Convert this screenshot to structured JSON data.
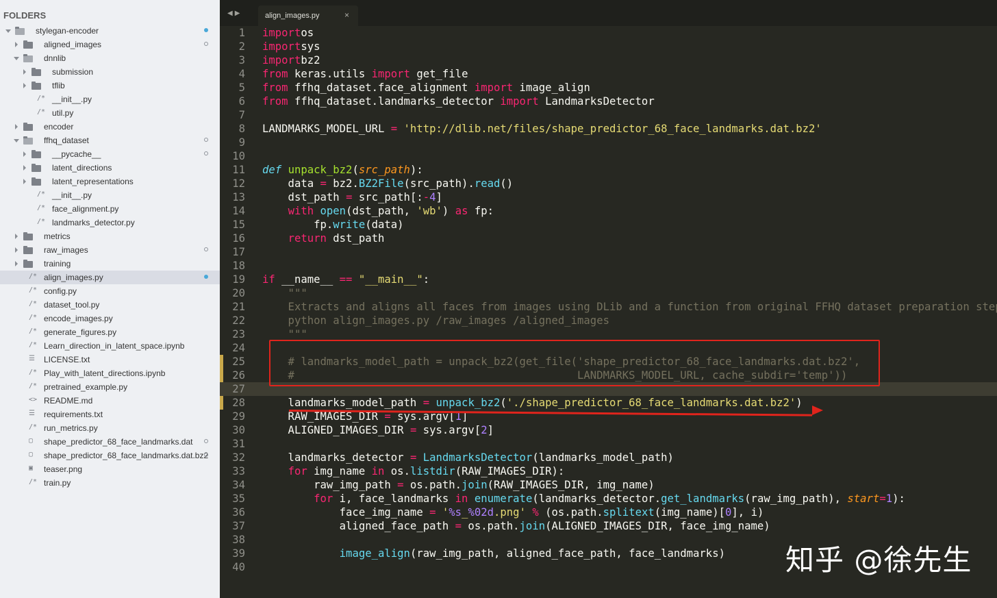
{
  "sidebar": {
    "header": "FOLDERS",
    "items": [
      {
        "label": "stylegan-encoder",
        "type": "folder",
        "depth": 0,
        "open": true,
        "indicator": "filled"
      },
      {
        "label": "aligned_images",
        "type": "folder",
        "depth": 1,
        "open": false,
        "indicator": "hollow"
      },
      {
        "label": "dnnlib",
        "type": "folder",
        "depth": 1,
        "open": true,
        "indicator": ""
      },
      {
        "label": "submission",
        "type": "folder",
        "depth": 2,
        "open": false,
        "indicator": ""
      },
      {
        "label": "tflib",
        "type": "folder",
        "depth": 2,
        "open": false,
        "indicator": ""
      },
      {
        "label": "__init__.py",
        "type": "code",
        "depth": 2,
        "indicator": ""
      },
      {
        "label": "util.py",
        "type": "code",
        "depth": 2,
        "indicator": ""
      },
      {
        "label": "encoder",
        "type": "folder",
        "depth": 1,
        "open": false,
        "indicator": ""
      },
      {
        "label": "ffhq_dataset",
        "type": "folder",
        "depth": 1,
        "open": true,
        "indicator": "hollow"
      },
      {
        "label": "__pycache__",
        "type": "folder",
        "depth": 2,
        "open": false,
        "indicator": "hollow"
      },
      {
        "label": "latent_directions",
        "type": "folder",
        "depth": 2,
        "open": false,
        "indicator": ""
      },
      {
        "label": "latent_representations",
        "type": "folder",
        "depth": 2,
        "open": false,
        "indicator": ""
      },
      {
        "label": "__init__.py",
        "type": "code",
        "depth": 2,
        "indicator": ""
      },
      {
        "label": "face_alignment.py",
        "type": "code",
        "depth": 2,
        "indicator": ""
      },
      {
        "label": "landmarks_detector.py",
        "type": "code",
        "depth": 2,
        "indicator": ""
      },
      {
        "label": "metrics",
        "type": "folder",
        "depth": 1,
        "open": false,
        "indicator": ""
      },
      {
        "label": "raw_images",
        "type": "folder",
        "depth": 1,
        "open": false,
        "indicator": "hollow"
      },
      {
        "label": "training",
        "type": "folder",
        "depth": 1,
        "open": false,
        "indicator": ""
      },
      {
        "label": "align_images.py",
        "type": "code",
        "depth": 1,
        "indicator": "filled",
        "selected": true
      },
      {
        "label": "config.py",
        "type": "code",
        "depth": 1,
        "indicator": ""
      },
      {
        "label": "dataset_tool.py",
        "type": "code",
        "depth": 1,
        "indicator": ""
      },
      {
        "label": "encode_images.py",
        "type": "code",
        "depth": 1,
        "indicator": ""
      },
      {
        "label": "generate_figures.py",
        "type": "code",
        "depth": 1,
        "indicator": ""
      },
      {
        "label": "Learn_direction_in_latent_space.ipynb",
        "type": "code",
        "depth": 1,
        "indicator": ""
      },
      {
        "label": "LICENSE.txt",
        "type": "text",
        "depth": 1,
        "indicator": ""
      },
      {
        "label": "Play_with_latent_directions.ipynb",
        "type": "code",
        "depth": 1,
        "indicator": ""
      },
      {
        "label": "pretrained_example.py",
        "type": "code",
        "depth": 1,
        "indicator": ""
      },
      {
        "label": "README.md",
        "type": "markup",
        "depth": 1,
        "indicator": ""
      },
      {
        "label": "requirements.txt",
        "type": "text",
        "depth": 1,
        "indicator": ""
      },
      {
        "label": "run_metrics.py",
        "type": "code",
        "depth": 1,
        "indicator": ""
      },
      {
        "label": "shape_predictor_68_face_landmarks.dat",
        "type": "blank",
        "depth": 1,
        "indicator": "hollow"
      },
      {
        "label": "shape_predictor_68_face_landmarks.dat.bz2",
        "type": "blank",
        "depth": 1,
        "indicator": "hollow"
      },
      {
        "label": "teaser.png",
        "type": "image",
        "depth": 1,
        "indicator": ""
      },
      {
        "label": "train.py",
        "type": "code",
        "depth": 1,
        "indicator": ""
      }
    ]
  },
  "tabbar": {
    "nav_arrows": "◀▶",
    "tab_label": "align_images.py",
    "close": "×"
  },
  "editor": {
    "active_line": 27,
    "lines": [
      [
        [
          "kw",
          "import"
        ],
        [
          "",
          "os"
        ]
      ],
      [
        [
          "kw",
          "import"
        ],
        [
          "",
          "sys"
        ]
      ],
      [
        [
          "kw",
          "import"
        ],
        [
          "",
          "bz2"
        ]
      ],
      [
        [
          "kw",
          "from"
        ],
        [
          "",
          " keras.utils "
        ],
        [
          "kw",
          "import"
        ],
        [
          "",
          " get_file"
        ]
      ],
      [
        [
          "kw",
          "from"
        ],
        [
          "",
          " ffhq_dataset.face_alignment "
        ],
        [
          "kw",
          "import"
        ],
        [
          "",
          " image_align"
        ]
      ],
      [
        [
          "kw",
          "from"
        ],
        [
          "",
          " ffhq_dataset.landmarks_detector "
        ],
        [
          "kw",
          "import"
        ],
        [
          "",
          " LandmarksDetector"
        ]
      ],
      [],
      [
        [
          "",
          "LANDMARKS_MODEL_URL "
        ],
        [
          "op",
          "="
        ],
        [
          " ",
          " "
        ],
        [
          "st",
          "'http://dlib.net/files/shape_predictor_68_face_landmarks.dat.bz2'"
        ]
      ],
      [],
      [],
      [
        [
          "df",
          "def"
        ],
        [
          "",
          " "
        ],
        [
          "fn",
          "unpack_bz2"
        ],
        [
          "",
          "("
        ],
        [
          "pa",
          "src_path"
        ],
        [
          "",
          "):"
        ]
      ],
      [
        [
          "",
          "    data "
        ],
        [
          "op",
          "="
        ],
        [
          "",
          " bz2."
        ],
        [
          "bi",
          "BZ2File"
        ],
        [
          "",
          "(src_path)."
        ],
        [
          "bi",
          "read"
        ],
        [
          "",
          "()"
        ]
      ],
      [
        [
          "",
          "    dst_path "
        ],
        [
          "op",
          "="
        ],
        [
          "",
          " src_path[:"
        ],
        [
          "op",
          "-"
        ],
        [
          "nu",
          "4"
        ],
        [
          "",
          "]"
        ]
      ],
      [
        [
          "",
          "    "
        ],
        [
          "kw",
          "with"
        ],
        [
          "",
          " "
        ],
        [
          "bi",
          "open"
        ],
        [
          "",
          "(dst_path, "
        ],
        [
          "st",
          "'wb'"
        ],
        [
          "",
          ") "
        ],
        [
          "kw",
          "as"
        ],
        [
          "",
          " fp:"
        ]
      ],
      [
        [
          "",
          "        fp."
        ],
        [
          "bi",
          "write"
        ],
        [
          "",
          "(data)"
        ]
      ],
      [
        [
          "",
          "    "
        ],
        [
          "kw",
          "return"
        ],
        [
          "",
          " dst_path"
        ]
      ],
      [],
      [],
      [
        [
          "kw",
          "if"
        ],
        [
          "",
          " __name__ "
        ],
        [
          "op",
          "=="
        ],
        [
          "",
          " "
        ],
        [
          "st",
          "\"__main__\""
        ],
        [
          "",
          ":"
        ]
      ],
      [
        [
          "cm",
          "    \"\"\""
        ]
      ],
      [
        [
          "cm",
          "    Extracts and aligns all faces from images using DLib and a function from original FFHQ dataset preparation step"
        ]
      ],
      [
        [
          "cm",
          "    python align_images.py /raw_images /aligned_images"
        ]
      ],
      [
        [
          "cm",
          "    \"\"\""
        ]
      ],
      [],
      [
        [
          "cm",
          "    # landmarks_model_path = unpack_bz2(get_file('shape_predictor_68_face_landmarks.dat.bz2',"
        ]
      ],
      [
        [
          "cm",
          "    #                                            LANDMARKS_MODEL_URL, cache_subdir='temp'))"
        ]
      ],
      [],
      [
        [
          "",
          "    landmarks_model_path "
        ],
        [
          "op",
          "="
        ],
        [
          "",
          " "
        ],
        [
          "bi",
          "unpack_bz2"
        ],
        [
          "",
          "("
        ],
        [
          "st",
          "'./shape_predictor_68_face_landmarks.dat.bz2'"
        ],
        [
          "",
          ")"
        ]
      ],
      [
        [
          "",
          "    RAW_IMAGES_DIR "
        ],
        [
          "op",
          "="
        ],
        [
          "",
          " sys.argv["
        ],
        [
          "nu",
          "1"
        ],
        [
          "",
          "]"
        ]
      ],
      [
        [
          "",
          "    ALIGNED_IMAGES_DIR "
        ],
        [
          "op",
          "="
        ],
        [
          "",
          " sys.argv["
        ],
        [
          "nu",
          "2"
        ],
        [
          "",
          "]"
        ]
      ],
      [],
      [
        [
          "",
          "    landmarks_detector "
        ],
        [
          "op",
          "="
        ],
        [
          "",
          " "
        ],
        [
          "bi",
          "LandmarksDetector"
        ],
        [
          "",
          "(landmarks_model_path)"
        ]
      ],
      [
        [
          "",
          "    "
        ],
        [
          "kw",
          "for"
        ],
        [
          "",
          " img_name "
        ],
        [
          "kw",
          "in"
        ],
        [
          "",
          " os."
        ],
        [
          "bi",
          "listdir"
        ],
        [
          "",
          "(RAW_IMAGES_DIR):"
        ]
      ],
      [
        [
          "",
          "        raw_img_path "
        ],
        [
          "op",
          "="
        ],
        [
          "",
          " os.path."
        ],
        [
          "bi",
          "join"
        ],
        [
          "",
          "(RAW_IMAGES_DIR, img_name)"
        ]
      ],
      [
        [
          "",
          "        "
        ],
        [
          "kw",
          "for"
        ],
        [
          "",
          " i, face_landmarks "
        ],
        [
          "kw",
          "in"
        ],
        [
          "",
          " "
        ],
        [
          "bi",
          "enumerate"
        ],
        [
          "",
          "(landmarks_detector."
        ],
        [
          "bi",
          "get_landmarks"
        ],
        [
          "",
          "(raw_img_path), "
        ],
        [
          "pa",
          "start"
        ],
        [
          "op",
          "="
        ],
        [
          "nu",
          "1"
        ],
        [
          "",
          "):"
        ]
      ],
      [
        [
          "",
          "            face_img_name "
        ],
        [
          "op",
          "="
        ],
        [
          "",
          " "
        ],
        [
          "st",
          "'"
        ],
        [
          "nu",
          "%s"
        ],
        [
          "st",
          "_"
        ],
        [
          "nu",
          "%02d"
        ],
        [
          "st",
          ".png'"
        ],
        [
          "",
          " "
        ],
        [
          "op",
          "%"
        ],
        [
          "",
          " (os.path."
        ],
        [
          "bi",
          "splitext"
        ],
        [
          "",
          "(img_name)["
        ],
        [
          "nu",
          "0"
        ],
        [
          "",
          "], i)"
        ]
      ],
      [
        [
          "",
          "            aligned_face_path "
        ],
        [
          "op",
          "="
        ],
        [
          "",
          " os.path."
        ],
        [
          "bi",
          "join"
        ],
        [
          "",
          "(ALIGNED_IMAGES_DIR, face_img_name)"
        ]
      ],
      [],
      [
        [
          "",
          "            "
        ],
        [
          "bi",
          "image_align"
        ],
        [
          "",
          "(raw_img_path, aligned_face_path, face_landmarks)"
        ]
      ],
      []
    ]
  },
  "watermark": "知乎 @徐先生",
  "colors": {
    "accent_red": "#e0241c",
    "selection": "#49a8d8"
  }
}
